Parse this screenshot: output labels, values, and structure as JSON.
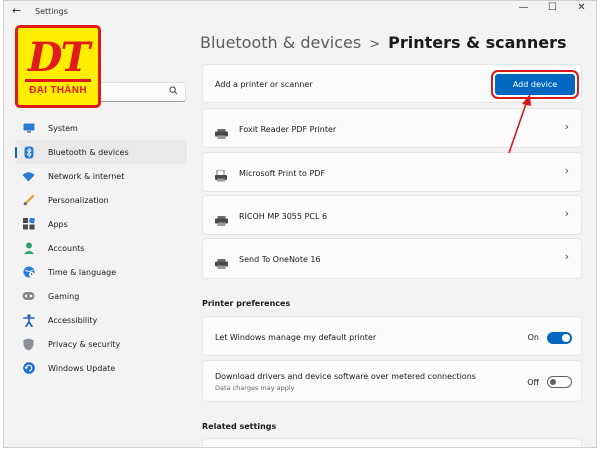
{
  "window": {
    "app_title": "Settings",
    "back_glyph": "←",
    "controls": {
      "minimize": "—",
      "maximize": "☐",
      "close": "✕"
    }
  },
  "logo": {
    "letters": "DT",
    "name": "ĐẠI THÀNH"
  },
  "search": {
    "value": "",
    "placeholder": "",
    "icon": "search-icon"
  },
  "sidebar": {
    "items": [
      {
        "label": "System",
        "icon": "system-icon",
        "active": false
      },
      {
        "label": "Bluetooth & devices",
        "icon": "bluetooth-icon",
        "active": true
      },
      {
        "label": "Network & internet",
        "icon": "wifi-icon",
        "active": false
      },
      {
        "label": "Personalization",
        "icon": "brush-icon",
        "active": false
      },
      {
        "label": "Apps",
        "icon": "apps-icon",
        "active": false
      },
      {
        "label": "Accounts",
        "icon": "accounts-icon",
        "active": false
      },
      {
        "label": "Time & language",
        "icon": "globe-clock-icon",
        "active": false
      },
      {
        "label": "Gaming",
        "icon": "gamepad-icon",
        "active": false
      },
      {
        "label": "Accessibility",
        "icon": "accessibility-icon",
        "active": false
      },
      {
        "label": "Privacy & security",
        "icon": "shield-icon",
        "active": false
      },
      {
        "label": "Windows Update",
        "icon": "update-icon",
        "active": false
      }
    ]
  },
  "header": {
    "parent": "Bluetooth & devices",
    "separator": ">",
    "current": "Printers & scanners"
  },
  "add_printer": {
    "label": "Add a printer or scanner",
    "button": "Add device"
  },
  "printers": [
    {
      "name": "Foxit Reader PDF Printer",
      "icon": "printer-icon"
    },
    {
      "name": "Microsoft Print to PDF",
      "icon": "printer-pdf-icon"
    },
    {
      "name": "RICOH MP 3055 PCL 6",
      "icon": "printer-icon"
    },
    {
      "name": "Send To OneNote 16",
      "icon": "printer-icon"
    }
  ],
  "chevron_glyph": "›",
  "preferences": {
    "title": "Printer preferences",
    "items": [
      {
        "label": "Let Windows manage my default printer",
        "sub": "",
        "state_label": "On",
        "enabled": true
      },
      {
        "label": "Download drivers and device software over metered connections",
        "sub": "Data charges may apply",
        "state_label": "Off",
        "enabled": false
      }
    ]
  },
  "related": {
    "title": "Related settings"
  },
  "colors": {
    "accent": "#0067c0",
    "highlight_red": "#d81b1b",
    "logo_yellow": "#ffee00",
    "logo_red": "#e01b1b"
  }
}
